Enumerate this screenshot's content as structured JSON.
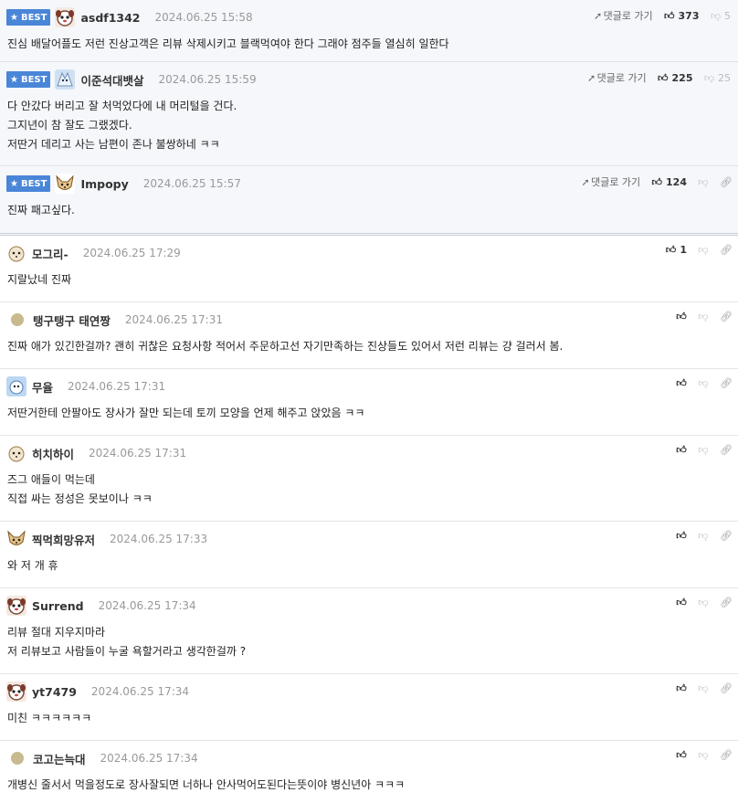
{
  "ui": {
    "best_label": "BEST",
    "reply_label": "댓글로 가기"
  },
  "best_comments": [
    {
      "nick": "asdf1342",
      "date": "2024.06.25 15:58",
      "up": "373",
      "down": "5",
      "lines": [
        "진심 배달어플도 저런 진상고객은 리뷰 삭제시키고 블랙먹여야 한다 그래야 점주들 열심히 일한다"
      ]
    },
    {
      "nick": "이준석대뱃살",
      "date": "2024.06.25 15:59",
      "up": "225",
      "down": "25",
      "lines": [
        "다 안갔다 버리고 잘 처먹었다에 내 머리털을 건다.",
        "그지년이 참 잘도 그랬겠다.",
        "저딴거 데리고 사는 남편이 존나 불쌍하네 ㅋㅋ"
      ]
    },
    {
      "nick": "Impopy",
      "date": "2024.06.25 15:57",
      "up": "124",
      "down": "",
      "lines": [
        "진짜 패고싶다."
      ]
    }
  ],
  "comments": [
    {
      "nick": "모그리-",
      "date": "2024.06.25 17:29",
      "up": "1",
      "lines": [
        "지랄났네 진짜"
      ]
    },
    {
      "nick": "탱구탱구 태연짱",
      "date": "2024.06.25 17:31",
      "up": "",
      "lines": [
        "진짜 애가 있긴한걸까? 괜히 귀찮은 요청사항 적어서 주문하고선 자기만족하는 진상들도 있어서 저런 리뷰는 걍 걸러서 봄."
      ]
    },
    {
      "nick": "무율",
      "date": "2024.06.25 17:31",
      "up": "",
      "lines": [
        "저딴거한테 안팔아도 장사가 잘만 되는데 토끼 모양을 언제 해주고 앉았음 ㅋㅋ"
      ]
    },
    {
      "nick": "히치하이",
      "date": "2024.06.25 17:31",
      "up": "",
      "lines": [
        "즈그 애들이 먹는데",
        "직접 싸는 정성은 못보이나 ㅋㅋ"
      ]
    },
    {
      "nick": "찍먹희망유저",
      "date": "2024.06.25 17:33",
      "up": "",
      "lines": [
        "와 저 개 휴"
      ]
    },
    {
      "nick": "Surrend",
      "date": "2024.06.25 17:34",
      "up": "",
      "lines": [
        "리뷰 절대 지우지마라",
        "저 리뷰보고 사람들이 누굴 욕할거라고 생각한걸까 ?"
      ]
    },
    {
      "nick": "yt7479",
      "date": "2024.06.25 17:34",
      "up": "",
      "lines": [
        "미친 ㅋㅋㅋㅋㅋㅋ"
      ]
    },
    {
      "nick": "코고는늑대",
      "date": "2024.06.25 17:34",
      "up": "",
      "lines": [
        "개병신 줄서서 먹을정도로 장사잘되면 너하나 안사먹어도된다는뜻이야 병신년아 ㅋㅋㅋ"
      ]
    }
  ],
  "icons": {
    "star": "star-icon",
    "thumb_up": "thumbs-up-icon",
    "thumb_down": "thumbs-down-icon",
    "reply_arrow": "reply-arrow-icon",
    "link": "link-icon"
  },
  "colors": {
    "best_badge": "#4a86d8",
    "best_background": "#f5f7fb"
  }
}
